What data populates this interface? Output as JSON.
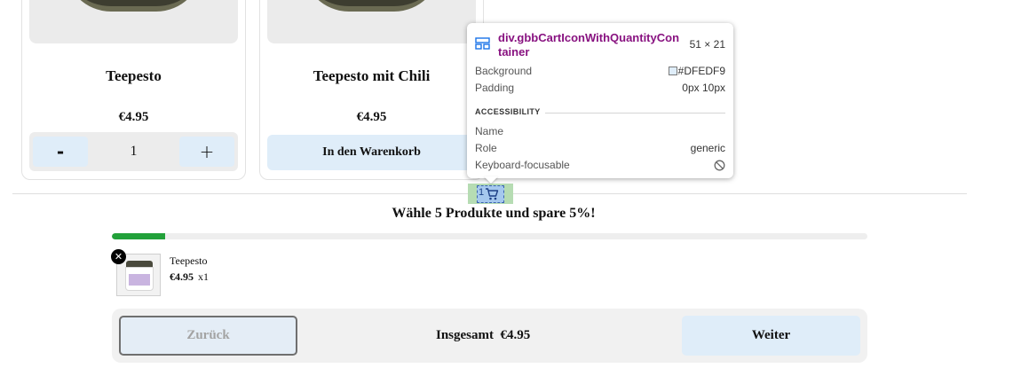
{
  "products": [
    {
      "title": "Teepesto",
      "price": "€4.95",
      "quantity": "1",
      "minus_label": "-",
      "plus_label": "+"
    },
    {
      "title": "Teepesto mit Chili",
      "price": "€4.95",
      "add_to_cart_label": "In den Warenkorb"
    }
  ],
  "cart_icon": {
    "quantity": "1",
    "icon": "cart-icon"
  },
  "bundle": {
    "promo_text": "Wähle 5 Produkte und spare 5%!",
    "progress": 0.07,
    "progress_color": "#22a13a",
    "items": [
      {
        "name": "Teepesto",
        "price": "€4.95",
        "qty": "x1",
        "remove_label": "✕",
        "image_label": "Teepesto"
      }
    ]
  },
  "footer": {
    "back_label": "Zurück",
    "total_label": "Insgesamt",
    "total_value": "€4.95",
    "next_label": "Weiter"
  },
  "inspector_tooltip": {
    "selector": "div.gbbCartIconWithQuantityContainer",
    "size": "51 × 21",
    "rows": [
      {
        "key": "Background",
        "value": "#DFEDF9"
      },
      {
        "key": "Padding",
        "value": "0px 10px"
      }
    ],
    "section_title": "ACCESSIBILITY",
    "accessibility": [
      {
        "key": "Name",
        "value": ""
      },
      {
        "key": "Role",
        "value": "generic"
      },
      {
        "key": "Keyboard-focusable",
        "value": ""
      }
    ]
  },
  "colors": {
    "button_bg": "#DFEDF9",
    "selector_color": "#881280",
    "highlight_margin": "#b6dcb3",
    "highlight_content": "#a5c8ee"
  }
}
